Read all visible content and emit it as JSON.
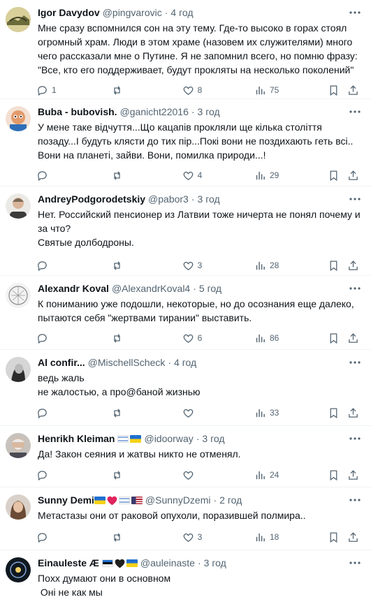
{
  "icons": {
    "reply": "reply-icon",
    "retweet": "retweet-icon",
    "like": "like-heart-icon",
    "views": "views-bar-chart-icon",
    "bookmark": "bookmark-icon",
    "share": "share-upload-icon",
    "more": "more-options-icon"
  },
  "colors": {
    "text": "#0f1419",
    "secondary": "#536471",
    "divider": "#eff3f4"
  },
  "tweets": [
    {
      "name": "Igor Davydov",
      "handle": "@pingvarovic",
      "time": "4 год",
      "text": "Мне сразу вспомнился сон на эту тему. Где-то высоко в горах стоял огромный храм. Люди в этом храме (назовем их служителями) много чего рассказали мне о Путине. Я не запомнил всего, но помню фразу: \"Все, кто его поддерживает, будут прокляты на несколько поколений\"",
      "replies": "1",
      "retweets": "",
      "likes": "8",
      "views": "75"
    },
    {
      "name": "Buba - bubovish.",
      "handle": "@ganicht22016",
      "time": "3 год",
      "text": "У мене таке відчуття...Що кацапів прокляли ще кілька століття позаду...І будуть клясти до тих пір...Покі вони не поздихають геть всі.. Вони на планеті, зайви. Вони, помилка природи...!",
      "replies": "",
      "retweets": "",
      "likes": "4",
      "views": "29"
    },
    {
      "name": "AndreyPodgorodetskiy",
      "handle": "@pabor3",
      "time": "3 год",
      "text": "Нет. Российский пенсионер из Латвии тоже ничерта не понял почему и за что?\nСвятые долбодроны.",
      "replies": "",
      "retweets": "",
      "likes": "3",
      "views": "28"
    },
    {
      "name": "Alexandr Koval",
      "handle": "@AlexandrKoval4",
      "time": "5 год",
      "text": "К пониманию уже подошли, некоторые, но до осознания еще далеко, пытаются себя \"жертвами тирании\" выставить.",
      "replies": "",
      "retweets": "",
      "likes": "6",
      "views": "86"
    },
    {
      "name": "Al confir...",
      "handle": "@MischellScheck",
      "time": "4 год",
      "text": "ведь жаль\nне жалостью, а про@баной жизнью",
      "replies": "",
      "retweets": "",
      "likes": "",
      "views": "33"
    },
    {
      "name": "Henrikh Kleiman",
      "handle": "@idoorway",
      "time": "3 год",
      "flags": [
        "israel",
        "ukraine"
      ],
      "text": "Да! Закон сеяния и жатвы никто не отменял.",
      "replies": "",
      "retweets": "",
      "likes": "",
      "views": "24"
    },
    {
      "name": "Sunny Demi",
      "handle": "@SunnyDzemi",
      "time": "2 год",
      "flags": [
        "ukraine",
        "heart-red",
        "israel",
        "usa"
      ],
      "text": "Метастазы они от раковой опухоли, поразившей полмира..",
      "replies": "",
      "retweets": "",
      "likes": "3",
      "views": "18"
    },
    {
      "name": "Einauleste Æ",
      "handle": "@auleinaste",
      "time": "3 год",
      "flags": [
        "estonia",
        "heart-black",
        "ukraine"
      ],
      "text": "Поxx думают они в основном\n Оні не как мы",
      "replies": "",
      "retweets": "",
      "likes": "",
      "views": ""
    }
  ]
}
